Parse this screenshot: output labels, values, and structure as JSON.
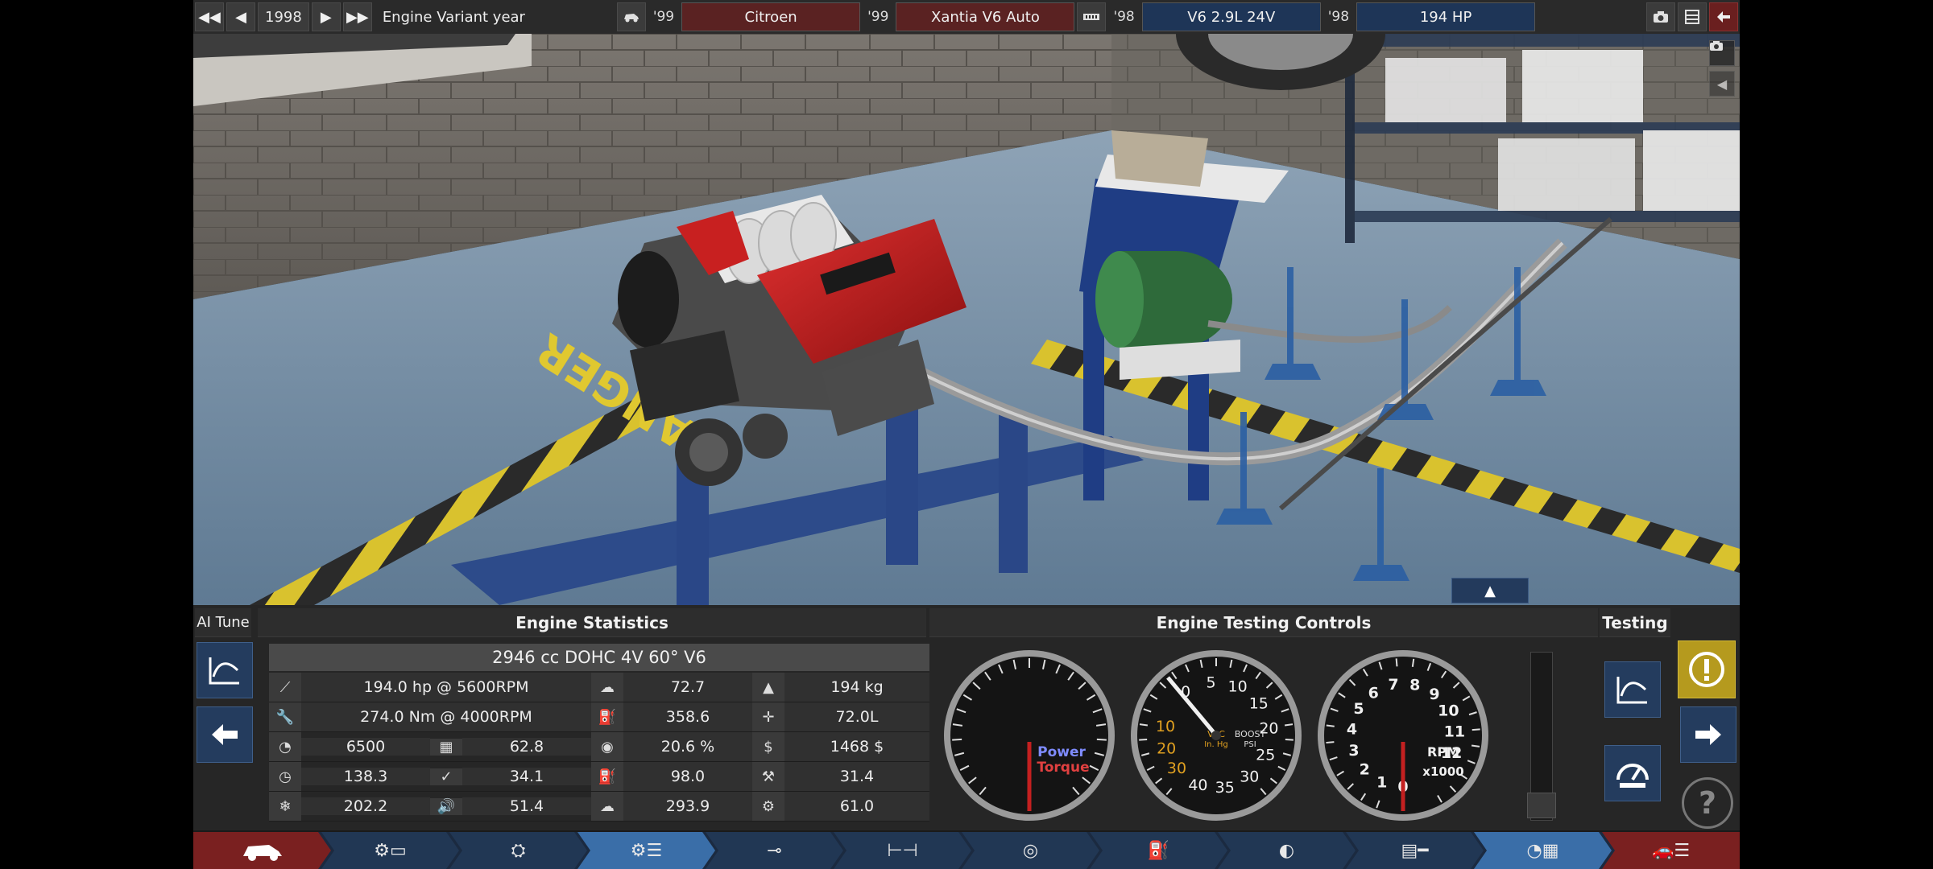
{
  "topbar": {
    "year": "1998",
    "mode_label": "Engine Variant year",
    "car_year": "'99",
    "brand": "Citroen",
    "model_year": "'99",
    "model": "Xantia V6 Auto",
    "engine_year": "'98",
    "engine": "V6 2.9L 24V",
    "variant_year": "'98",
    "variant": "194 HP"
  },
  "panel": {
    "ai_tune_label": "AI Tune",
    "stats_header": "Engine Statistics",
    "controls_header": "Engine Testing Controls",
    "testing_header": "Testing",
    "engine_title": "2946 cc DOHC 4V 60° V6",
    "stats": {
      "power": "194.0 hp @ 5600RPM",
      "torque": "274.0 Nm @ 4000RPM",
      "rpm_limit": "6500",
      "c1": "62.8",
      "r3c": "138.3",
      "c2": "34.1",
      "r5c": "202.2",
      "c3": "51.4",
      "mid1": "72.7",
      "mid2": "358.6",
      "mid3": "20.6 %",
      "mid4": "98.0",
      "mid5": "293.9",
      "right1": "194 kg",
      "right2": "72.0L",
      "right3": "1468 $",
      "right4": "31.4",
      "right5": "61.0"
    },
    "gauges": {
      "power_label": "Power",
      "torque_label": "Torque",
      "vac_label": "VAC",
      "vac_unit": "In. Hg",
      "boost_label": "BOOST",
      "boost_unit": "PSI",
      "rpm_label": "RPM",
      "rpm_unit": "x1000",
      "vac_ticks": [
        "10",
        "20",
        "30"
      ],
      "boost_ticks": [
        "0",
        "5",
        "10",
        "15",
        "20",
        "25",
        "30",
        "35",
        "40"
      ],
      "rpm_ticks": [
        "0",
        "1",
        "2",
        "3",
        "4",
        "5",
        "6",
        "7",
        "8",
        "9",
        "10",
        "11",
        "12"
      ]
    },
    "help_label": "?"
  },
  "colors": {
    "accent_blue": "#243c5e",
    "accent_red": "#5a2222",
    "warning": "#b59a1e",
    "needle": "#c42020"
  }
}
